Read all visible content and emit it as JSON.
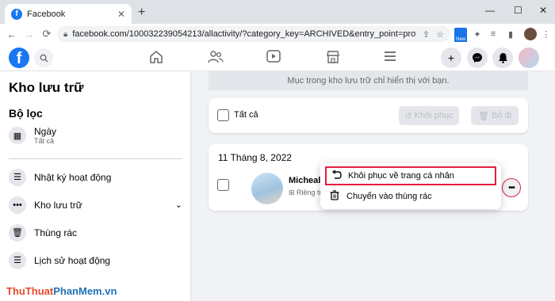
{
  "browser": {
    "tab_title": "Facebook",
    "tab_close": "✕",
    "new_tab": "+",
    "window_controls": [
      "—",
      "☐",
      "✕"
    ],
    "nav": {
      "back": "←",
      "forward": "→",
      "reload": "C"
    },
    "url": "facebook.com/100032239054213/allactivity/?category_key=ARCHIVED&entry_point=profile_shortcut",
    "extension_badge": "New",
    "icons": [
      "share-icon",
      "star-icon",
      "puzzle-icon",
      "media-icon",
      "sidepanel-icon",
      "profile-avatar",
      "kebab-menu-icon"
    ]
  },
  "fb_header": {
    "logo": "f",
    "nav_icons": [
      "home-icon",
      "friends-icon",
      "watch-icon",
      "marketplace-icon",
      "menu-icon"
    ],
    "right_icons": [
      "create-icon",
      "messenger-icon",
      "notifications-icon",
      "account-avatar"
    ]
  },
  "sidebar": {
    "title": "Kho lưu trữ",
    "filter_heading": "Bộ lọc",
    "filter": {
      "label": "Ngày",
      "sub": "Tất cả"
    },
    "items": [
      {
        "label": "Nhật ký hoạt động",
        "icon": "list-icon"
      },
      {
        "label": "Kho lưu trữ",
        "icon": "more-dots-icon",
        "expanded": true
      },
      {
        "label": "Thùng rác",
        "icon": "trash-icon"
      },
      {
        "label": "Lịch sử hoạt động",
        "icon": "list-icon"
      }
    ]
  },
  "main": {
    "banner": "Mục trong kho lưu trữ chỉ hiển thị với bạn.",
    "select_all": "Tất cả",
    "restore_btn": "Khôi phục",
    "remove_btn": "Bỏ đi",
    "date_header": "11 Tháng 8, 2022",
    "post": {
      "author": "Micheal T",
      "meta": "⊞ Riêng tư"
    },
    "menu": [
      {
        "label": "Khôi phục về trang cá nhân",
        "icon": "restore-icon",
        "highlighted": true
      },
      {
        "label": "Chuyển vào thùng rác",
        "icon": "trash-icon",
        "highlighted": false
      }
    ]
  },
  "watermark": {
    "part1": "ThuThuat",
    "part2": "PhanMem",
    "part3": ".vn"
  },
  "colors": {
    "facebook_blue": "#1877f2",
    "highlight_red": "#e41e3f"
  }
}
